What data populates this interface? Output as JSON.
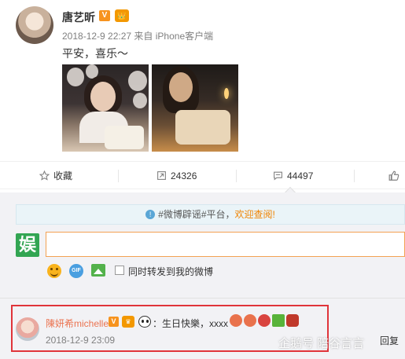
{
  "post": {
    "username": "唐艺昕",
    "verified_badge": "V",
    "member_badge": "👑",
    "time": "2018-12-9 22:27",
    "source": "来自 iPhone客户端",
    "text": "平安，喜乐～",
    "photos": [
      "photo-1",
      "photo-2"
    ]
  },
  "actions": {
    "favorite_label": "收藏",
    "forward_count": "24326",
    "comment_count": "44497",
    "icons": {
      "favorite": "star-icon",
      "forward": "forward-icon",
      "comment": "comment-icon",
      "like": "thumb-up-icon"
    }
  },
  "notice": {
    "text": "#微博辟谣#平台，",
    "welcome": "欢迎查阅!"
  },
  "composer": {
    "avatar_char": "娱",
    "input_value": "",
    "also_forward_label": "同时转发到我的微博",
    "also_forward_checked": false
  },
  "comment": {
    "username": "陳妍希michelle",
    "verified_badge": "V",
    "text": "：生日快樂，xxxx",
    "emoji_colors": [
      "#e9724c",
      "#e9724c",
      "#d9443f",
      "#58b33a",
      "#c0392b"
    ],
    "date": "2018-12-9 23:09",
    "reply_label": "回复",
    "watermark": "企鹅号 陪谷言言"
  },
  "colors": {
    "accent_orange": "#eb7350",
    "highlight_red": "#e0343a",
    "link_orange": "#f08300"
  }
}
